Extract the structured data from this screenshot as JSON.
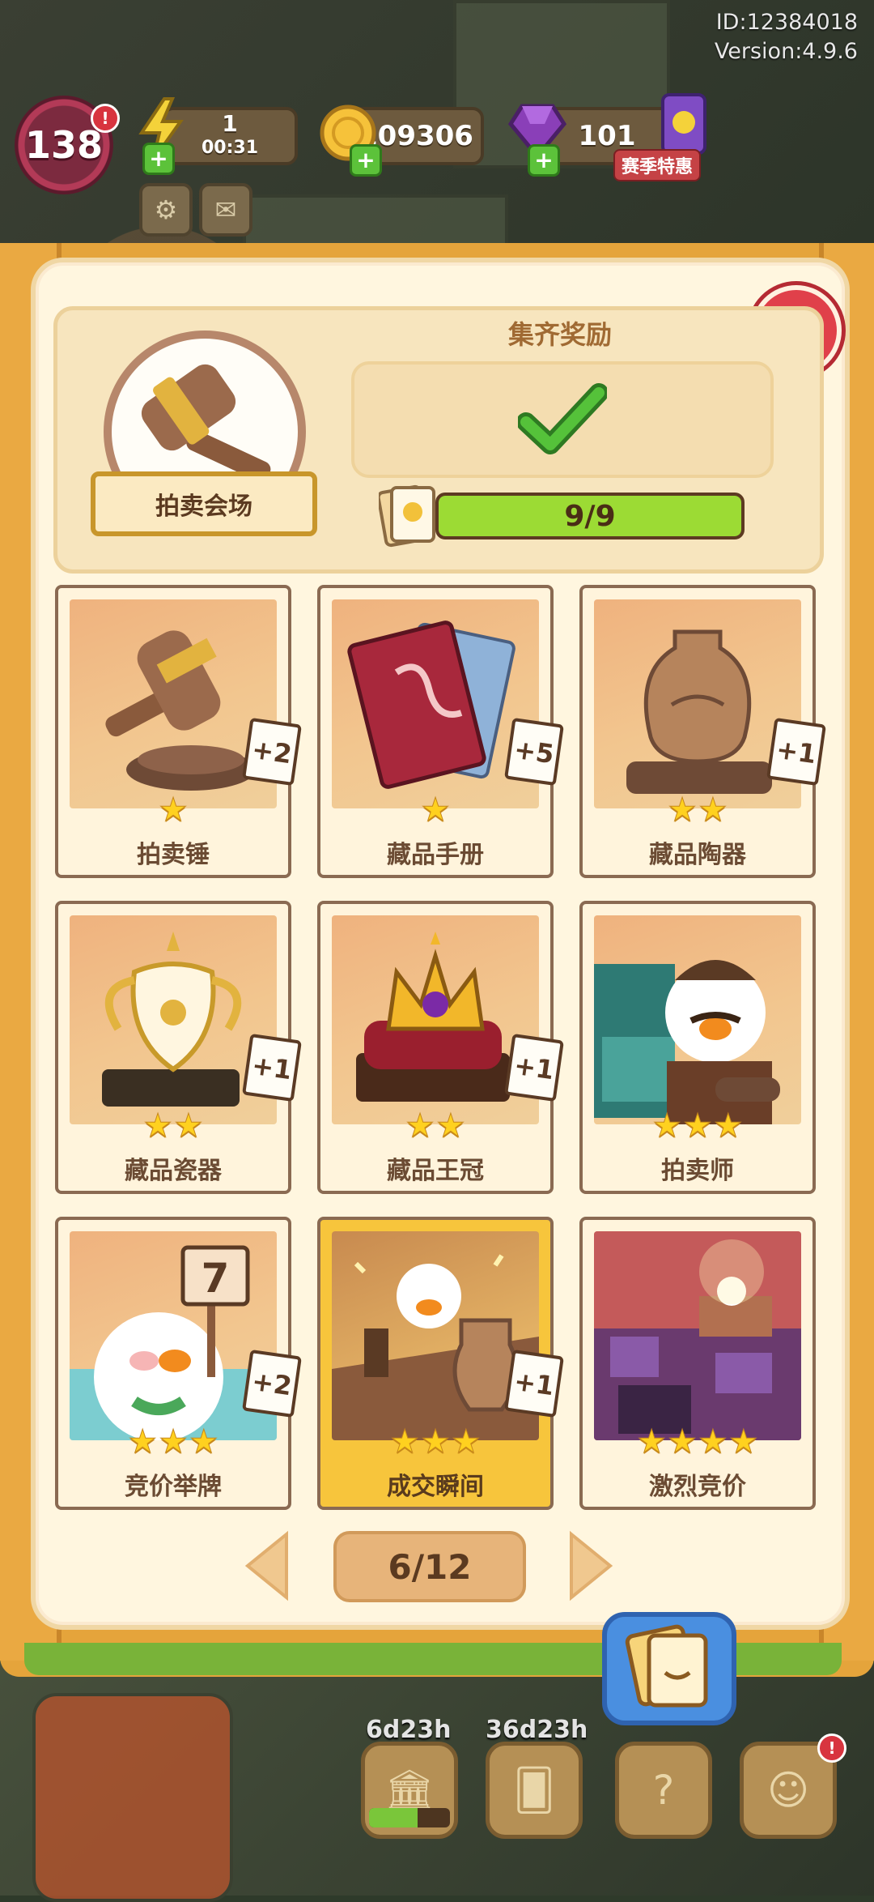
{
  "meta": {
    "id_text": "ID:12384018",
    "version_text": "Version:4.9.6"
  },
  "hud": {
    "level": "138",
    "level_alert": "!",
    "energy_value": "1",
    "energy_timer": "00:31",
    "coins": "109306",
    "gems": "101",
    "season_offer": "赛季特惠"
  },
  "collection": {
    "set_name": "拍卖会场",
    "reward_title": "集齐奖励",
    "progress_text": "9/9",
    "progress_fraction": 1.0,
    "reward_claimed": true
  },
  "cards": [
    {
      "name": "拍卖锤",
      "stars": 1,
      "badge": "+2",
      "selected": false
    },
    {
      "name": "藏品手册",
      "stars": 1,
      "badge": "+5",
      "selected": false
    },
    {
      "name": "藏品陶器",
      "stars": 2,
      "badge": "+1",
      "selected": false
    },
    {
      "name": "藏品瓷器",
      "stars": 2,
      "badge": "+1",
      "selected": false
    },
    {
      "name": "藏品王冠",
      "stars": 2,
      "badge": "+1",
      "selected": false
    },
    {
      "name": "拍卖师",
      "stars": 3,
      "badge": "",
      "selected": false
    },
    {
      "name": "竞价举牌",
      "stars": 3,
      "badge": "+2",
      "selected": false
    },
    {
      "name": "成交瞬间",
      "stars": 3,
      "badge": "+1",
      "selected": true
    },
    {
      "name": "激烈竞价",
      "stars": 4,
      "badge": "",
      "selected": false
    }
  ],
  "card_art": {
    "sign_number": "7"
  },
  "pager": {
    "text": "6/12"
  },
  "bottom": {
    "timer_1": "6d23h",
    "timer_2": "36d23h",
    "alert": "!"
  },
  "colors": {
    "accent_green": "#9cdb34",
    "close_red": "#e0404a",
    "panel_bg": "#fff6df",
    "book_orange": "#e5a43b"
  }
}
